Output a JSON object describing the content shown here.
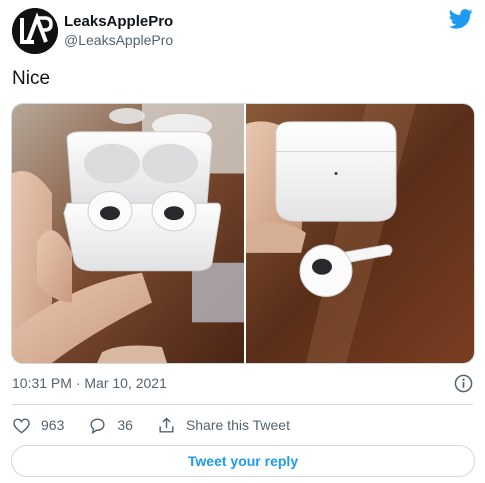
{
  "author": {
    "display_name": "LeaksApplePro",
    "handle": "@LeaksApplePro",
    "avatar_icon": "lap-logo-icon"
  },
  "brand_icon": "twitter-bird-icon",
  "tweet": {
    "text": "Nice",
    "timestamp": "10:31 PM · Mar 10, 2021"
  },
  "media": {
    "images": [
      {
        "name": "airpods-open-case-photo"
      },
      {
        "name": "airpods-closed-case-photo"
      }
    ]
  },
  "actions": {
    "like_count": "963",
    "reply_count": "36",
    "share_label": "Share this Tweet"
  },
  "reply_button_label": "Tweet your reply",
  "colors": {
    "accent": "#1d9bf0",
    "text": "#0f1419",
    "secondary": "#536471",
    "border": "#cfd9de"
  }
}
